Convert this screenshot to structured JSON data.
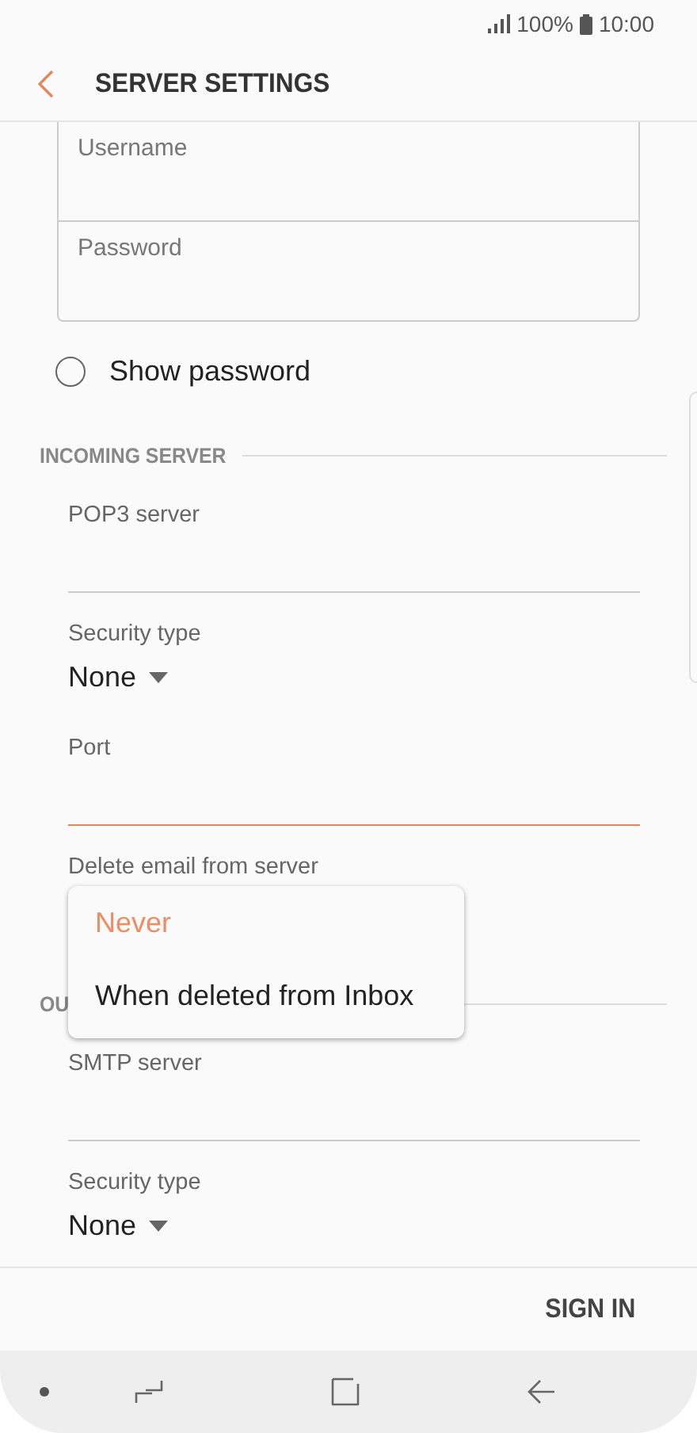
{
  "status_bar": {
    "battery": "100%",
    "time": "10:00"
  },
  "header": {
    "title": "SERVER SETTINGS"
  },
  "credentials": [
    {
      "placeholder": "Username"
    },
    {
      "placeholder": "Password"
    }
  ],
  "show_password": {
    "label": "Show password",
    "checked": false
  },
  "incoming": {
    "heading": "INCOMING SERVER",
    "fields": [
      {
        "kind": "text",
        "label": "POP3 server",
        "focused": false
      },
      {
        "kind": "select",
        "label": "Security type",
        "value": "None"
      },
      {
        "kind": "text",
        "label": "Port",
        "focused": true
      },
      {
        "kind": "label",
        "label": "Delete email from server"
      }
    ]
  },
  "outgoing": {
    "heading": "OU",
    "fields": [
      {
        "kind": "text",
        "label": "SMTP server",
        "focused": false
      },
      {
        "kind": "select",
        "label": "Security type",
        "value": "None"
      }
    ]
  },
  "menu": [
    {
      "label": "Never",
      "selected": true
    },
    {
      "label": "When deleted from Inbox",
      "selected": false
    }
  ],
  "footer": {
    "button": "SIGN IN"
  }
}
